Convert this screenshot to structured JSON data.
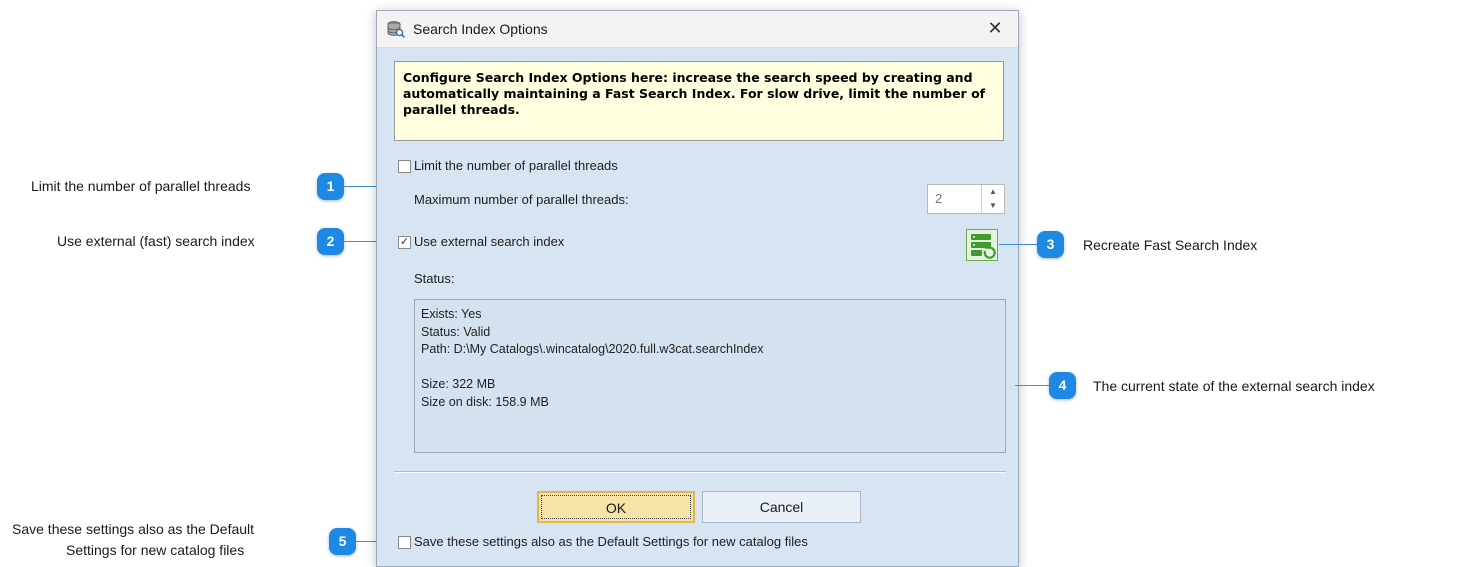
{
  "dialog": {
    "title": "Search Index Options",
    "close_symbol": "✕",
    "info_text": "Configure Search Index Options here: increase the search speed by creating and automatically maintaining a Fast Search Index. For slow drive, limit the number of parallel threads.",
    "limit_threads_label": "Limit the number of parallel threads",
    "limit_threads_checked": false,
    "max_threads_label": "Maximum number of parallel threads:",
    "max_threads_value": "2",
    "use_external_label": "Use external search index",
    "use_external_checked": true,
    "status_label": "Status:",
    "status_lines": [
      "Exists: Yes",
      "Status: Valid",
      "Path: D:\\My Catalogs\\.wincatalog\\2020.full.w3cat.searchIndex",
      "",
      "Size: 322 MB",
      "Size on disk: 158.9 MB"
    ],
    "ok_label": "OK",
    "cancel_label": "Cancel",
    "save_default_label": "Save these settings also as the Default Settings for new catalog files",
    "save_default_checked": false
  },
  "callouts": [
    {
      "number": "1",
      "text": "Limit the number of parallel threads"
    },
    {
      "number": "2",
      "text": "Use external (fast) search index"
    },
    {
      "number": "3",
      "text": "Recreate Fast Search Index"
    },
    {
      "number": "4",
      "text": "The current state of the external search index"
    },
    {
      "number": "5",
      "text_line1": "Save these settings also as the Default",
      "text_line2": "Settings for new catalog files"
    }
  ],
  "colors": {
    "callout_blue": "#1e88e5",
    "info_bg": "#ffffe0",
    "dialog_bg": "#d7e4f2",
    "ok_bg": "#f7e2a8"
  },
  "icons": {
    "title": "database-search-icon",
    "recreate": "recreate-index-icon"
  }
}
